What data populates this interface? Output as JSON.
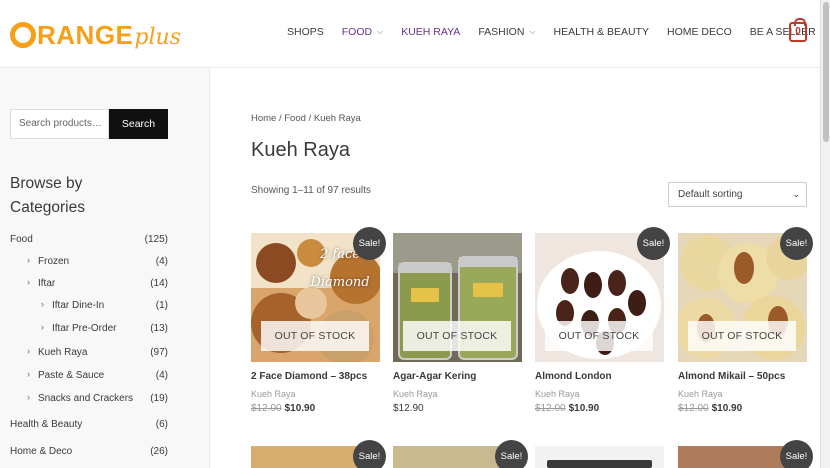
{
  "header": {
    "logo_main": "RANGE",
    "logo_suffix": "plus",
    "nav": [
      {
        "label": "SHOPS",
        "dropdown": false
      },
      {
        "label": "FOOD",
        "dropdown": true
      },
      {
        "label": "KUEH RAYA",
        "dropdown": false
      },
      {
        "label": "FASHION",
        "dropdown": true
      },
      {
        "label": "HEALTH & BEAUTY",
        "dropdown": false
      },
      {
        "label": "HOME DECO",
        "dropdown": false
      },
      {
        "label": "BE A SELLER",
        "dropdown": false
      }
    ],
    "cart_count": "0"
  },
  "sidebar": {
    "search_placeholder": "Search products…",
    "search_button": "Search",
    "browse_title": "Browse by Categories",
    "categories": [
      {
        "name": "Food",
        "count": "(125)",
        "level": 0
      },
      {
        "name": "Frozen",
        "count": "(4)",
        "level": 1
      },
      {
        "name": "Iftar",
        "count": "(14)",
        "level": 1
      },
      {
        "name": "Iftar Dine-In",
        "count": "(1)",
        "level": 2
      },
      {
        "name": "Iftar Pre-Order",
        "count": "(13)",
        "level": 2
      },
      {
        "name": "Kueh Raya",
        "count": "(97)",
        "level": 1
      },
      {
        "name": "Paste & Sauce",
        "count": "(4)",
        "level": 1
      },
      {
        "name": "Snacks and Crackers",
        "count": "(19)",
        "level": 1
      },
      {
        "name": "Health & Beauty",
        "count": "(6)",
        "level": 0
      },
      {
        "name": "Home & Deco",
        "count": "(26)",
        "level": 0
      }
    ]
  },
  "main": {
    "breadcrumb": "Home / Food / Kueh Raya",
    "title": "Kueh Raya",
    "result_count": "Showing 1–11 of 97 results",
    "sort_selected": "Default sorting",
    "out_of_stock_label": "OUT OF STOCK",
    "sale_label": "Sale!",
    "products": [
      {
        "name": "2 Face Diamond – 38pcs",
        "category": "Kueh Raya",
        "old_price": "$12.00",
        "price": "$10.90",
        "overlay_text": "2 face\nDiamond"
      },
      {
        "name": "Agar-Agar Kering",
        "category": "Kueh Raya",
        "old_price": "",
        "price": "$12.90"
      },
      {
        "name": "Almond London",
        "category": "Kueh Raya",
        "old_price": "$12.00",
        "price": "$10.90"
      },
      {
        "name": "Almond Mikail – 50pcs",
        "category": "Kueh Raya",
        "old_price": "$12.00",
        "price": "$10.90"
      }
    ]
  },
  "colors": {
    "brand_orange": "#f6a01a",
    "nav_active": "#6b2f93",
    "sale_badge": "#444444",
    "search_button": "#111111"
  }
}
